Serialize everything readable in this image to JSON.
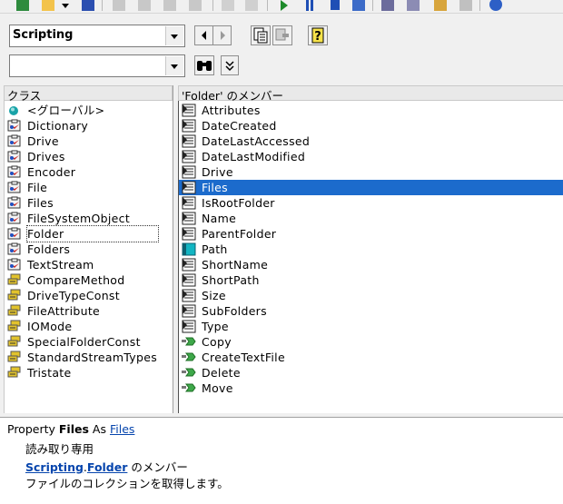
{
  "toolbar": {
    "icons": [
      "excel-icon",
      "module-icon",
      "dropdown-icon",
      "save-icon",
      "cut-icon",
      "copy-icon",
      "paste-icon",
      "find-icon",
      "undo-icon",
      "redo-icon",
      "run-icon",
      "break-icon",
      "reset-icon",
      "design-mode-icon",
      "project-explorer-icon",
      "properties-icon",
      "object-browser-icon",
      "toolbox-icon",
      "help-icon"
    ]
  },
  "library_combo": {
    "value": "Scripting"
  },
  "search_combo": {
    "value": ""
  },
  "panes": {
    "classes_header": "クラス",
    "members_header": "'Folder' のメンバー"
  },
  "classes": [
    {
      "label": "<グローバル>",
      "icon": "globe"
    },
    {
      "label": "Dictionary",
      "icon": "class"
    },
    {
      "label": "Drive",
      "icon": "class"
    },
    {
      "label": "Drives",
      "icon": "class"
    },
    {
      "label": "Encoder",
      "icon": "class"
    },
    {
      "label": "File",
      "icon": "class"
    },
    {
      "label": "Files",
      "icon": "class"
    },
    {
      "label": "FileSystemObject",
      "icon": "class"
    },
    {
      "label": "Folder",
      "icon": "class",
      "focus": true
    },
    {
      "label": "Folders",
      "icon": "class"
    },
    {
      "label": "TextStream",
      "icon": "class"
    },
    {
      "label": "CompareMethod",
      "icon": "enum"
    },
    {
      "label": "DriveTypeConst",
      "icon": "enum"
    },
    {
      "label": "FileAttribute",
      "icon": "enum"
    },
    {
      "label": "IOMode",
      "icon": "enum"
    },
    {
      "label": "SpecialFolderConst",
      "icon": "enum"
    },
    {
      "label": "StandardStreamTypes",
      "icon": "enum"
    },
    {
      "label": "Tristate",
      "icon": "enum"
    }
  ],
  "members": [
    {
      "label": "Attributes",
      "icon": "property"
    },
    {
      "label": "DateCreated",
      "icon": "property"
    },
    {
      "label": "DateLastAccessed",
      "icon": "property"
    },
    {
      "label": "DateLastModified",
      "icon": "property"
    },
    {
      "label": "Drive",
      "icon": "property"
    },
    {
      "label": "Files",
      "icon": "property",
      "selected": true
    },
    {
      "label": "IsRootFolder",
      "icon": "property"
    },
    {
      "label": "Name",
      "icon": "property"
    },
    {
      "label": "ParentFolder",
      "icon": "property"
    },
    {
      "label": "Path",
      "icon": "default-property"
    },
    {
      "label": "ShortName",
      "icon": "property"
    },
    {
      "label": "ShortPath",
      "icon": "property"
    },
    {
      "label": "Size",
      "icon": "property"
    },
    {
      "label": "SubFolders",
      "icon": "property"
    },
    {
      "label": "Type",
      "icon": "property"
    },
    {
      "label": "Copy",
      "icon": "method"
    },
    {
      "label": "CreateTextFile",
      "icon": "method"
    },
    {
      "label": "Delete",
      "icon": "method"
    },
    {
      "label": "Move",
      "icon": "method"
    }
  ],
  "details": {
    "kw_property": "Property",
    "name": "Files",
    "kw_as": "As",
    "type_link": "Files",
    "readonly": "読み取り専用",
    "lib_link": "Scripting",
    "dot": ".",
    "class_link": "Folder",
    "member_of": "のメンバー",
    "description": "ファイルのコレクションを取得します。"
  }
}
